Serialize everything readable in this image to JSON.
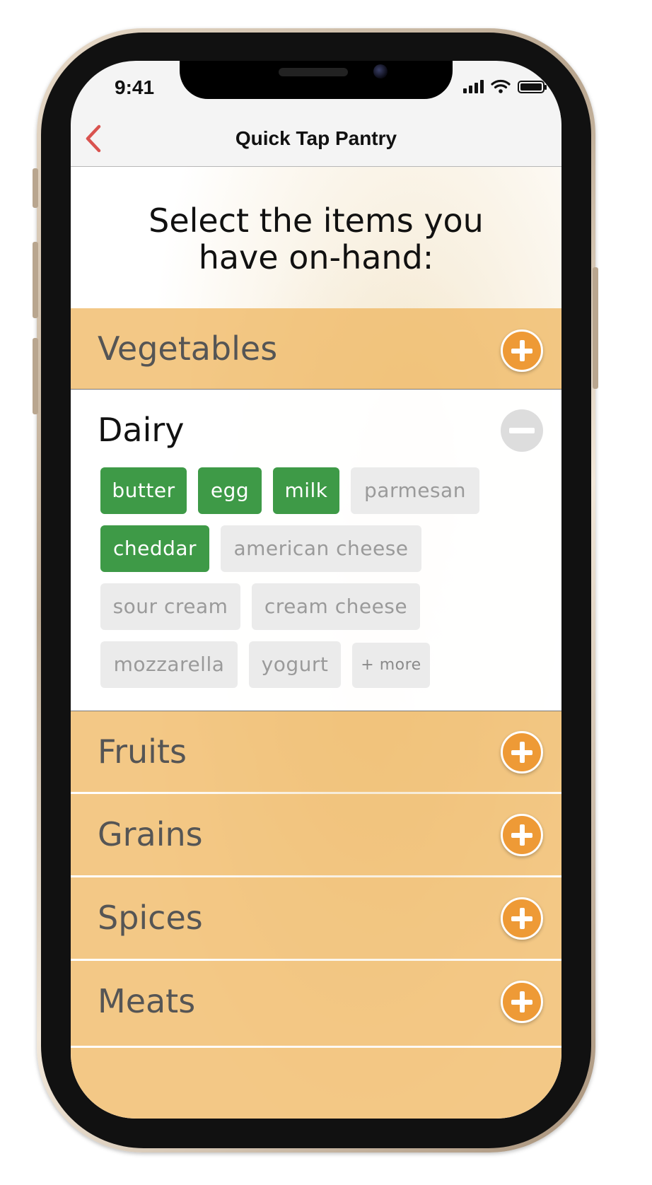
{
  "status_bar": {
    "time": "9:41",
    "icons": [
      "signal-bars-icon",
      "wifi-icon",
      "battery-icon"
    ]
  },
  "nav": {
    "back_icon": "chevron-left-icon",
    "title": "Quick Tap Pantry"
  },
  "prompt": {
    "line1": "Select the items you",
    "line2": "have on-hand:"
  },
  "categories": [
    {
      "label": "Vegetables",
      "expanded": false
    },
    {
      "label": "Dairy",
      "expanded": true
    },
    {
      "label": "Fruits",
      "expanded": false
    },
    {
      "label": "Grains",
      "expanded": false
    },
    {
      "label": "Spices",
      "expanded": false
    },
    {
      "label": "Meats",
      "expanded": false
    }
  ],
  "dairy": {
    "title": "Dairy",
    "items": [
      {
        "label": "butter",
        "selected": true
      },
      {
        "label": "egg",
        "selected": true
      },
      {
        "label": "milk",
        "selected": true
      },
      {
        "label": "parmesan",
        "selected": false
      },
      {
        "label": "cheddar",
        "selected": true
      },
      {
        "label": "american cheese",
        "selected": false
      },
      {
        "label": "sour cream",
        "selected": false
      },
      {
        "label": "cream cheese",
        "selected": false
      },
      {
        "label": "mozzarella",
        "selected": false
      },
      {
        "label": "yogurt",
        "selected": false
      }
    ],
    "more_label": "+ more"
  },
  "colors": {
    "accent_back": "#d9534f",
    "category_bg": "#efb964",
    "plus_button": "#ee9a36",
    "chip_selected": "#3e9a47",
    "chip_unselected": "#ebebeb"
  }
}
